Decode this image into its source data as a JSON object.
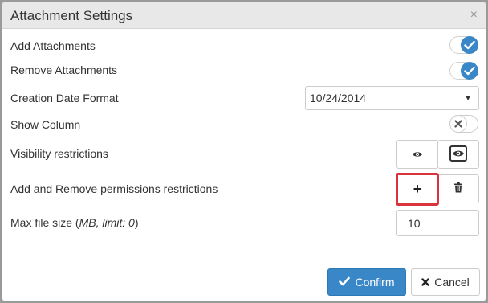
{
  "dialog": {
    "title": "Attachment Settings",
    "close_glyph": "×"
  },
  "rows": {
    "add_attachments": {
      "label": "Add Attachments",
      "enabled": true
    },
    "remove_attachments": {
      "label": "Remove Attachments",
      "enabled": true
    },
    "creation_date_format": {
      "label": "Creation Date Format",
      "selected": "10/24/2014"
    },
    "show_column": {
      "label": "Show Column",
      "enabled": false
    },
    "visibility_restrictions": {
      "label": "Visibility restrictions",
      "icons": [
        "eye-icon",
        "eye-framed-icon"
      ]
    },
    "permissions_restrictions": {
      "label": "Add and Remove permissions restrictions",
      "icons": [
        "plus-icon",
        "trash-icon"
      ],
      "plus_glyph": "+"
    },
    "max_file_size": {
      "label_prefix": "Max file size (",
      "label_italic": "MB, limit: 0",
      "label_suffix": ")",
      "value": "10"
    }
  },
  "footer": {
    "confirm_label": "Confirm",
    "cancel_label": "Cancel"
  },
  "colors": {
    "accent": "#3a87c8",
    "highlight": "#d9343d"
  }
}
